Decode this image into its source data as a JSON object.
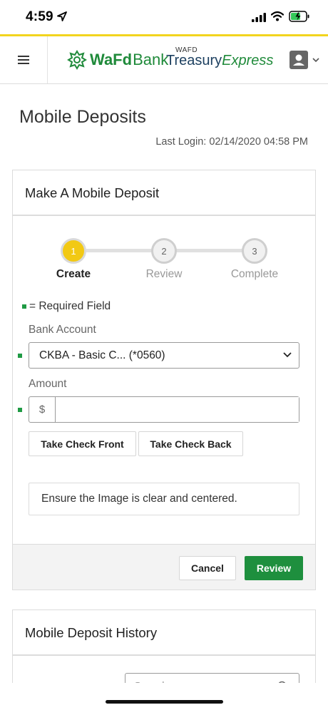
{
  "status_bar": {
    "time": "4:59"
  },
  "header": {
    "brand_wafd": "WaFd",
    "brand_bank": "Bank",
    "product_small": "WAFD",
    "product_treasury": "Treasury",
    "product_express": "Express"
  },
  "page": {
    "title": "Mobile Deposits",
    "last_login": "Last Login: 02/14/2020 04:58 PM"
  },
  "deposit_card": {
    "title": "Make A Mobile Deposit",
    "steps": [
      {
        "number": "1",
        "label": "Create",
        "active": true
      },
      {
        "number": "2",
        "label": "Review",
        "active": false
      },
      {
        "number": "3",
        "label": "Complete",
        "active": false
      }
    ],
    "required_legend": "= Required Field",
    "bank_account_label": "Bank Account",
    "bank_account_value": "CKBA - Basic C... (*0560)",
    "amount_label": "Amount",
    "amount_prefix": "$",
    "amount_value": "",
    "take_front_label": "Take Check Front",
    "take_back_label": "Take Check Back",
    "info_text": "Ensure the Image is clear and centered.",
    "cancel_label": "Cancel",
    "review_label": "Review"
  },
  "history_card": {
    "title": "Mobile Deposit History",
    "search_placeholder": "Search..."
  },
  "colors": {
    "accent_green": "#1e8f3e",
    "step_active": "#f2c914",
    "top_line": "#f2d41e",
    "brand_navy": "#1c3f5f"
  }
}
